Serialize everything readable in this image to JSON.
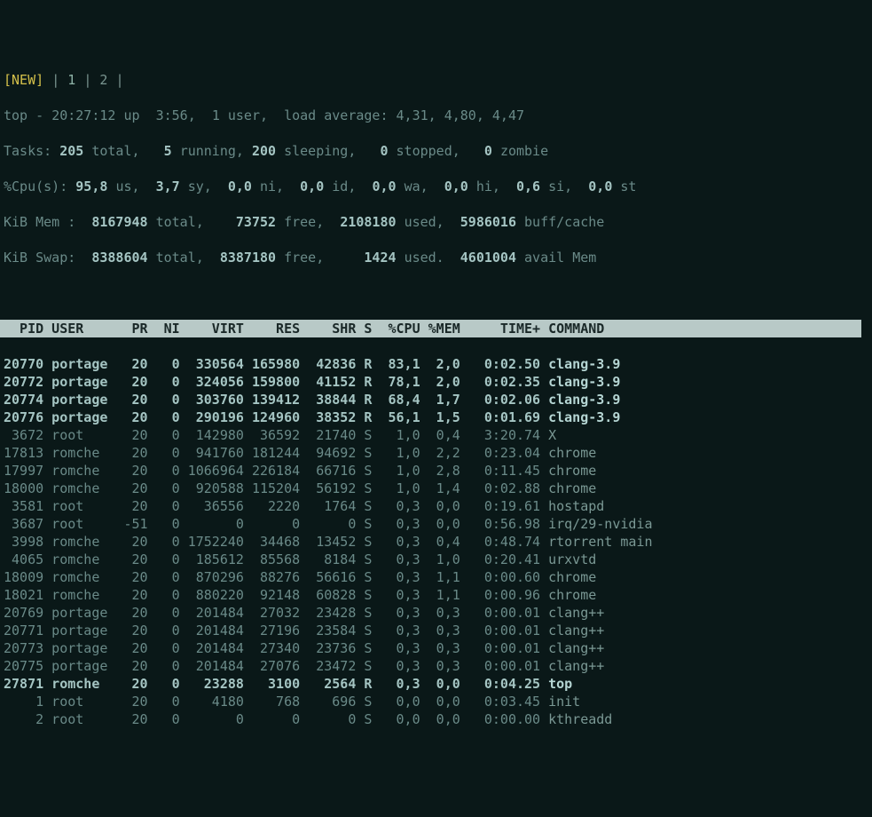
{
  "tabbar": {
    "new": "[NEW]",
    "tabs": [
      " 1 ",
      " 2 "
    ],
    "sep": "|"
  },
  "summary": {
    "line1": {
      "pre": "top - ",
      "time": "20:27:12",
      "up": " up  3:56,  ",
      "users_n": "1",
      "users_t": " user,  load average: ",
      "la": "4,31, 4,80, 4,47"
    },
    "line2": {
      "pre": "Tasks:",
      "total_n": " 205 ",
      "total_t": "total,   ",
      "run_n": "5 ",
      "run_t": "running, ",
      "sleep_n": "200 ",
      "sleep_t": "sleeping,   ",
      "stop_n": "0 ",
      "stop_t": "stopped,   ",
      "zomb_n": "0 ",
      "zomb_t": "zombie"
    },
    "line3": {
      "pre": "%Cpu(s):",
      "us_n": " 95,8 ",
      "us_t": "us,  ",
      "sy_n": "3,7 ",
      "sy_t": "sy,  ",
      "ni_n": "0,0 ",
      "ni_t": "ni,  ",
      "id_n": "0,0 ",
      "id_t": "id,  ",
      "wa_n": "0,0 ",
      "wa_t": "wa,  ",
      "hi_n": "0,0 ",
      "hi_t": "hi,  ",
      "si_n": "0,6 ",
      "si_t": "si,  ",
      "st_n": "0,0 ",
      "st_t": "st"
    },
    "line4": {
      "pre": "KiB Mem :  ",
      "tot_n": "8167948 ",
      "tot_t": "total,    ",
      "free_n": "73752 ",
      "free_t": "free,  ",
      "used_n": "2108180 ",
      "used_t": "used,  ",
      "buf_n": "5986016 ",
      "buf_t": "buff/cache"
    },
    "line5": {
      "pre": "KiB Swap:  ",
      "tot_n": "8388604 ",
      "tot_t": "total,  ",
      "free_n": "8387180 ",
      "free_t": "free,     ",
      "used_n": "1424 ",
      "used_t": "used.  ",
      "av_n": "4601004 ",
      "av_t": "avail Mem "
    }
  },
  "header": "  PID USER      PR  NI    VIRT    RES    SHR S  %CPU %MEM     TIME+ COMMAND",
  "processes": [
    {
      "b": true,
      "pid": "20770",
      "user": "portage",
      "pr": "20",
      "ni": "0",
      "virt": "330564",
      "res": "165980",
      "shr": "42836",
      "s": "R",
      "cpu": "83,1",
      "mem": "2,0",
      "time": "0:02.50",
      "cmd": "clang-3.9"
    },
    {
      "b": true,
      "pid": "20772",
      "user": "portage",
      "pr": "20",
      "ni": "0",
      "virt": "324056",
      "res": "159800",
      "shr": "41152",
      "s": "R",
      "cpu": "78,1",
      "mem": "2,0",
      "time": "0:02.35",
      "cmd": "clang-3.9"
    },
    {
      "b": true,
      "pid": "20774",
      "user": "portage",
      "pr": "20",
      "ni": "0",
      "virt": "303760",
      "res": "139412",
      "shr": "38844",
      "s": "R",
      "cpu": "68,4",
      "mem": "1,7",
      "time": "0:02.06",
      "cmd": "clang-3.9"
    },
    {
      "b": true,
      "pid": "20776",
      "user": "portage",
      "pr": "20",
      "ni": "0",
      "virt": "290196",
      "res": "124960",
      "shr": "38352",
      "s": "R",
      "cpu": "56,1",
      "mem": "1,5",
      "time": "0:01.69",
      "cmd": "clang-3.9"
    },
    {
      "b": false,
      "pid": "3672",
      "user": "root",
      "pr": "20",
      "ni": "0",
      "virt": "142980",
      "res": "36592",
      "shr": "21740",
      "s": "S",
      "cpu": "1,0",
      "mem": "0,4",
      "time": "3:20.74",
      "cmd": "X"
    },
    {
      "b": false,
      "pid": "17813",
      "user": "romche",
      "pr": "20",
      "ni": "0",
      "virt": "941760",
      "res": "181244",
      "shr": "94692",
      "s": "S",
      "cpu": "1,0",
      "mem": "2,2",
      "time": "0:23.04",
      "cmd": "chrome"
    },
    {
      "b": false,
      "pid": "17997",
      "user": "romche",
      "pr": "20",
      "ni": "0",
      "virt": "1066964",
      "res": "226184",
      "shr": "66716",
      "s": "S",
      "cpu": "1,0",
      "mem": "2,8",
      "time": "0:11.45",
      "cmd": "chrome"
    },
    {
      "b": false,
      "pid": "18000",
      "user": "romche",
      "pr": "20",
      "ni": "0",
      "virt": "920588",
      "res": "115204",
      "shr": "56192",
      "s": "S",
      "cpu": "1,0",
      "mem": "1,4",
      "time": "0:02.88",
      "cmd": "chrome"
    },
    {
      "b": false,
      "pid": "3581",
      "user": "root",
      "pr": "20",
      "ni": "0",
      "virt": "36556",
      "res": "2220",
      "shr": "1764",
      "s": "S",
      "cpu": "0,3",
      "mem": "0,0",
      "time": "0:19.61",
      "cmd": "hostapd"
    },
    {
      "b": false,
      "pid": "3687",
      "user": "root",
      "pr": "-51",
      "ni": "0",
      "virt": "0",
      "res": "0",
      "shr": "0",
      "s": "S",
      "cpu": "0,3",
      "mem": "0,0",
      "time": "0:56.98",
      "cmd": "irq/29-nvidia"
    },
    {
      "b": false,
      "pid": "3998",
      "user": "romche",
      "pr": "20",
      "ni": "0",
      "virt": "1752240",
      "res": "34468",
      "shr": "13452",
      "s": "S",
      "cpu": "0,3",
      "mem": "0,4",
      "time": "0:48.74",
      "cmd": "rtorrent main"
    },
    {
      "b": false,
      "pid": "4065",
      "user": "romche",
      "pr": "20",
      "ni": "0",
      "virt": "185612",
      "res": "85568",
      "shr": "8184",
      "s": "S",
      "cpu": "0,3",
      "mem": "1,0",
      "time": "0:20.41",
      "cmd": "urxvtd"
    },
    {
      "b": false,
      "pid": "18009",
      "user": "romche",
      "pr": "20",
      "ni": "0",
      "virt": "870296",
      "res": "88276",
      "shr": "56616",
      "s": "S",
      "cpu": "0,3",
      "mem": "1,1",
      "time": "0:00.60",
      "cmd": "chrome"
    },
    {
      "b": false,
      "pid": "18021",
      "user": "romche",
      "pr": "20",
      "ni": "0",
      "virt": "880220",
      "res": "92148",
      "shr": "60828",
      "s": "S",
      "cpu": "0,3",
      "mem": "1,1",
      "time": "0:00.96",
      "cmd": "chrome"
    },
    {
      "b": false,
      "pid": "20769",
      "user": "portage",
      "pr": "20",
      "ni": "0",
      "virt": "201484",
      "res": "27032",
      "shr": "23428",
      "s": "S",
      "cpu": "0,3",
      "mem": "0,3",
      "time": "0:00.01",
      "cmd": "clang++"
    },
    {
      "b": false,
      "pid": "20771",
      "user": "portage",
      "pr": "20",
      "ni": "0",
      "virt": "201484",
      "res": "27196",
      "shr": "23584",
      "s": "S",
      "cpu": "0,3",
      "mem": "0,3",
      "time": "0:00.01",
      "cmd": "clang++"
    },
    {
      "b": false,
      "pid": "20773",
      "user": "portage",
      "pr": "20",
      "ni": "0",
      "virt": "201484",
      "res": "27340",
      "shr": "23736",
      "s": "S",
      "cpu": "0,3",
      "mem": "0,3",
      "time": "0:00.01",
      "cmd": "clang++"
    },
    {
      "b": false,
      "pid": "20775",
      "user": "portage",
      "pr": "20",
      "ni": "0",
      "virt": "201484",
      "res": "27076",
      "shr": "23472",
      "s": "S",
      "cpu": "0,3",
      "mem": "0,3",
      "time": "0:00.01",
      "cmd": "clang++"
    },
    {
      "b": true,
      "pid": "27871",
      "user": "romche",
      "pr": "20",
      "ni": "0",
      "virt": "23288",
      "res": "3100",
      "shr": "2564",
      "s": "R",
      "cpu": "0,3",
      "mem": "0,0",
      "time": "0:04.25",
      "cmd": "top"
    },
    {
      "b": false,
      "pid": "1",
      "user": "root",
      "pr": "20",
      "ni": "0",
      "virt": "4180",
      "res": "768",
      "shr": "696",
      "s": "S",
      "cpu": "0,0",
      "mem": "0,0",
      "time": "0:03.45",
      "cmd": "init"
    },
    {
      "b": false,
      "pid": "2",
      "user": "root",
      "pr": "20",
      "ni": "0",
      "virt": "0",
      "res": "0",
      "shr": "0",
      "s": "S",
      "cpu": "0,0",
      "mem": "0,0",
      "time": "0:00.00",
      "cmd": "kthreadd"
    }
  ]
}
